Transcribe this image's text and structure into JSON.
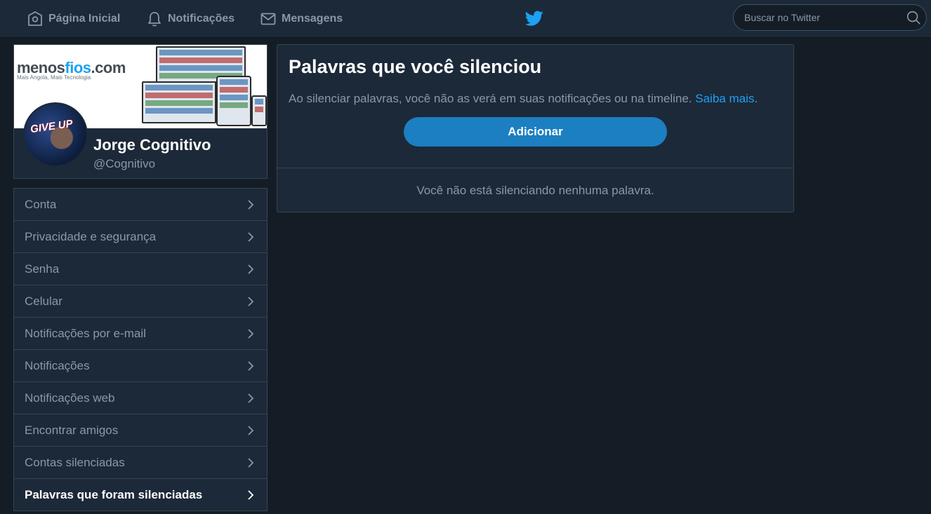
{
  "nav": {
    "home": "Página Inicial",
    "notifications": "Notificações",
    "messages": "Mensagens"
  },
  "search": {
    "placeholder": "Buscar no Twitter"
  },
  "profile": {
    "banner_logo_main": "menos",
    "banner_logo_accent": "fios",
    "banner_logo_suffix": ".com",
    "banner_tagline": "Mais Angola, Mais Tecnologia",
    "avatar_text": "GIVE UP",
    "name": "Jorge Cognitivo",
    "handle": "@Cognitivo"
  },
  "menu": {
    "items": [
      "Conta",
      "Privacidade e segurança",
      "Senha",
      "Celular",
      "Notificações por e-mail",
      "Notificações",
      "Notificações web",
      "Encontrar amigos",
      "Contas silenciadas",
      "Palavras que foram silenciadas"
    ]
  },
  "panel": {
    "title": "Palavras que você silenciou",
    "description": "Ao silenciar palavras, você não as verá em suas notificações ou na timeline.",
    "learn_more": "Saiba mais",
    "add_button": "Adicionar",
    "empty_message": "Você não está silenciando nenhuma palavra."
  },
  "colors": {
    "background": "#141d26",
    "surface": "#1c2938",
    "border": "#38444d",
    "accent": "#1da1f2",
    "button": "#1b7fc1"
  }
}
